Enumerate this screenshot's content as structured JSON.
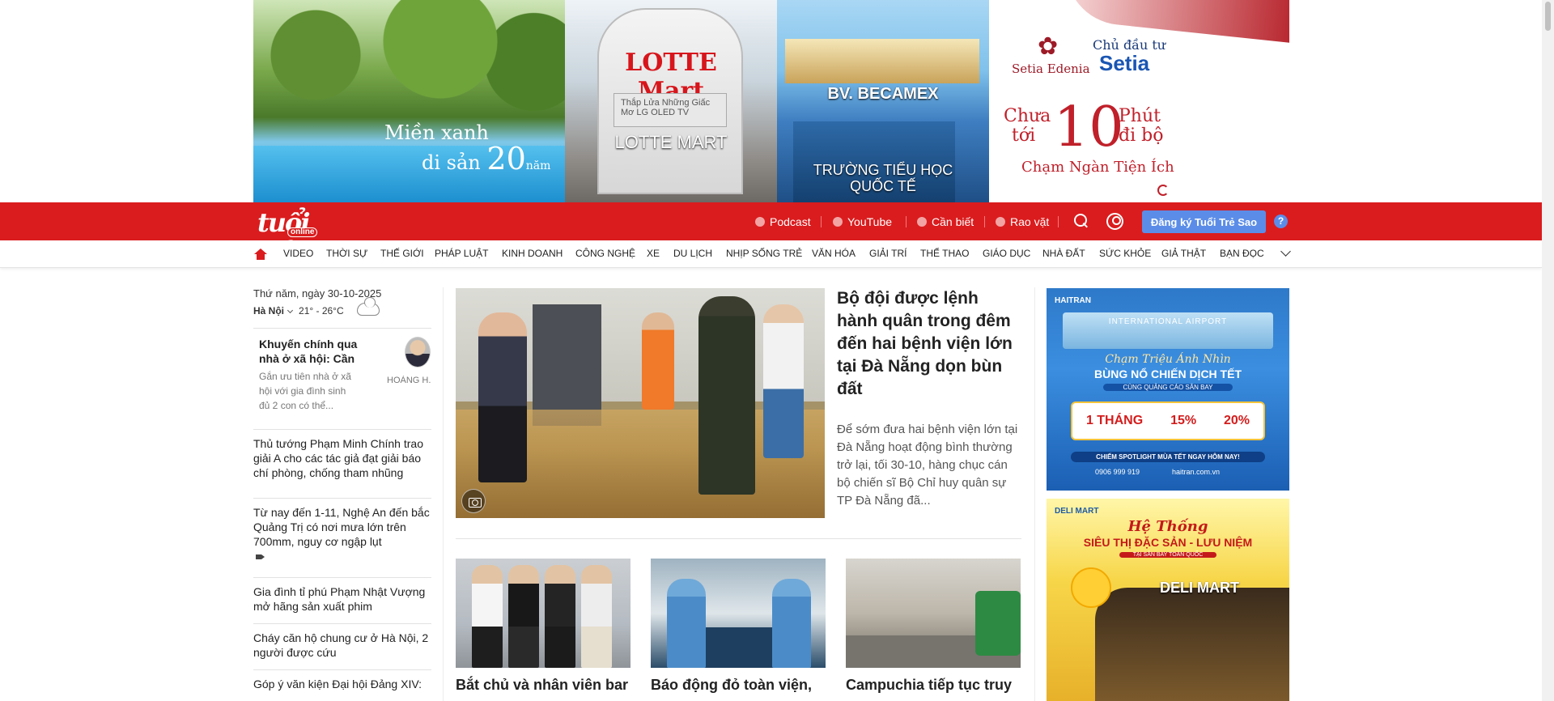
{
  "top_banner": {
    "panel1_line1": "Miền xanh",
    "panel1_line2_a": "di sản ",
    "panel1_line2_num": "20",
    "panel1_line2_unit": "năm",
    "panel2_logo": "LOTTE Mart",
    "panel2_tv": "Thắp Lửa Những Giấc Mơ  LG OLED TV",
    "panel2_caption": "LOTTE MART",
    "panel3_caption1": "BV. BECAMEX",
    "panel3_caption2_a": "TRƯỜNG TIỂU HỌC",
    "panel3_caption2_b": "QUỐC TẾ",
    "panel4_brand1": "Setia Edenia",
    "panel4_label": "Chủ đầu tư",
    "panel4_brand2": "Setia",
    "panel4_chua": "Chưa",
    "panel4_toi": "tới",
    "panel4_number": "10",
    "panel4_phut": "Phút",
    "panel4_dibo": "đi bộ",
    "panel4_slogan": "Chạm Ngàn Tiện Ích"
  },
  "header": {
    "logo_text": "tuổi trẻ",
    "logo_sub": "online",
    "links": [
      {
        "label": "Podcast",
        "icon": "microphone-icon"
      },
      {
        "label": "YouTube",
        "icon": "youtube-icon"
      },
      {
        "label": "Cần biết",
        "icon": "pin-icon"
      },
      {
        "label": "Rao vặt",
        "icon": "tag-icon"
      }
    ],
    "subscribe_label": "Đăng ký Tuổi Trẻ Sao",
    "help_label": "?"
  },
  "nav": {
    "categories": [
      "VIDEO",
      "THỜI SỰ",
      "THẾ GIỚI",
      "PHÁP LUẬT",
      "KINH DOANH",
      "CÔNG NGHỆ",
      "XE",
      "DU LỊCH",
      "NHỊP SỐNG TRẺ",
      "VĂN HÓA",
      "GIẢI TRÍ",
      "THỂ THAO",
      "GIÁO DỤC",
      "NHÀ ĐẤT",
      "SỨC KHỎE",
      "GIẢ THẬT",
      "BẠN ĐỌC"
    ]
  },
  "sidebar": {
    "date": "Thứ năm, ngày 30-10-2025",
    "city": "Hà Nội",
    "temperature": "21° - 26°C",
    "feature": {
      "title": "Khuyến chính qua nhà ở xã hội: Cần",
      "sapo": "Gắn ưu tiên nhà ở xã hội với gia đình sinh đủ 2 con có thể...",
      "author": "HOÀNG H..."
    },
    "items": [
      {
        "title": "Thủ tướng Phạm Minh Chính trao giải A cho các tác giả đạt giải báo chí phòng, chống tham nhũng"
      },
      {
        "title": "Từ nay đến 1-11, Nghệ An đến bắc Quảng Trị có nơi mưa lớn trên 700mm, nguy cơ ngập lụt"
      },
      {
        "title": "Gia đình tỉ phú Phạm Nhật Vượng mở hãng sản xuất phim"
      },
      {
        "title": "Cháy căn hộ chung cư ở Hà Nội, 2 người được cứu"
      },
      {
        "title": "Góp ý văn kiện Đại hội Đảng XIV:"
      }
    ]
  },
  "main": {
    "featured": {
      "title": "Bộ đội được lệnh hành quân trong đêm đến hai bệnh viện lớn tại Đà Nẵng dọn bùn đất",
      "sapo": "Để sớm đưa hai bệnh viện lớn tại Đà Nẵng hoạt động bình thường trở lại, tối 30-10, hàng chục cán bộ chiến sĩ Bộ Chỉ huy quân sự TP Đà Nẵng đã..."
    },
    "cards": [
      {
        "title": "Bắt chủ và nhân viên bar"
      },
      {
        "title": "Báo động đỏ toàn viện,"
      },
      {
        "title": "Campuchia tiếp tục truy"
      }
    ]
  },
  "ads": {
    "ad1": {
      "brand": "HAITRAN",
      "airport": "INTERNATIONAL AIRPORT",
      "line1": "Chạm Triệu Ánh Nhìn",
      "line2": "BÙNG NỔ CHIẾN DỊCH TẾT",
      "line3": "CÙNG QUẢNG CÁO SÂN BAY",
      "offer1": "1 THÁNG",
      "offer2": "15%",
      "offer3": "20%",
      "line4": "CHIẾM SPOTLIGHT MÙA TẾT NGAY HÔM NAY!",
      "phone": "0906 999 919",
      "web": "haitran.com.vn"
    },
    "ad2": {
      "brand": "DELI MART",
      "line1": "Hệ Thống",
      "line2": "SIÊU THỊ ĐẶC SẢN - LƯU NIỆM",
      "line3": "TẠI SÂN BAY TOÀN QUỐC",
      "store": "DELI MART"
    }
  }
}
